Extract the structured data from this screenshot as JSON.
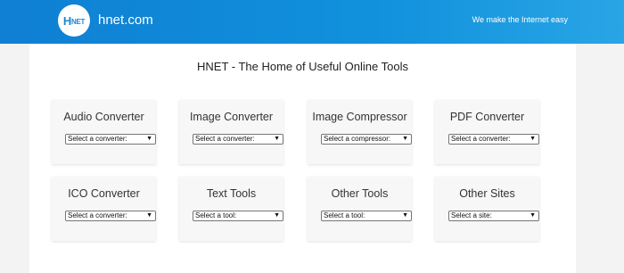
{
  "header": {
    "logo_text_main": "H",
    "logo_text_small": "NET",
    "site_name": "hnet.com",
    "tagline": "We make the Internet easy"
  },
  "main": {
    "title": "HNET - The Home of Useful Online Tools",
    "cards": [
      {
        "title": "Audio Converter",
        "select": "Select a converter:"
      },
      {
        "title": "Image Converter",
        "select": "Select a converter:"
      },
      {
        "title": "Image Compressor",
        "select": "Select a compressor:"
      },
      {
        "title": "PDF Converter",
        "select": "Select a converter:"
      },
      {
        "title": "ICO Converter",
        "select": "Select a converter:"
      },
      {
        "title": "Text Tools",
        "select": "Select a tool:"
      },
      {
        "title": "Other Tools",
        "select": "Select a tool:"
      },
      {
        "title": "Other Sites",
        "select": "Select a site:"
      }
    ]
  },
  "icons": {
    "dropdown": "chevron-down-icon"
  },
  "colors": {
    "header_start": "#0f7fd3",
    "header_end": "#29a5e6",
    "page_bg": "#f3f3f3",
    "card_bg": "#f7f7f7"
  }
}
